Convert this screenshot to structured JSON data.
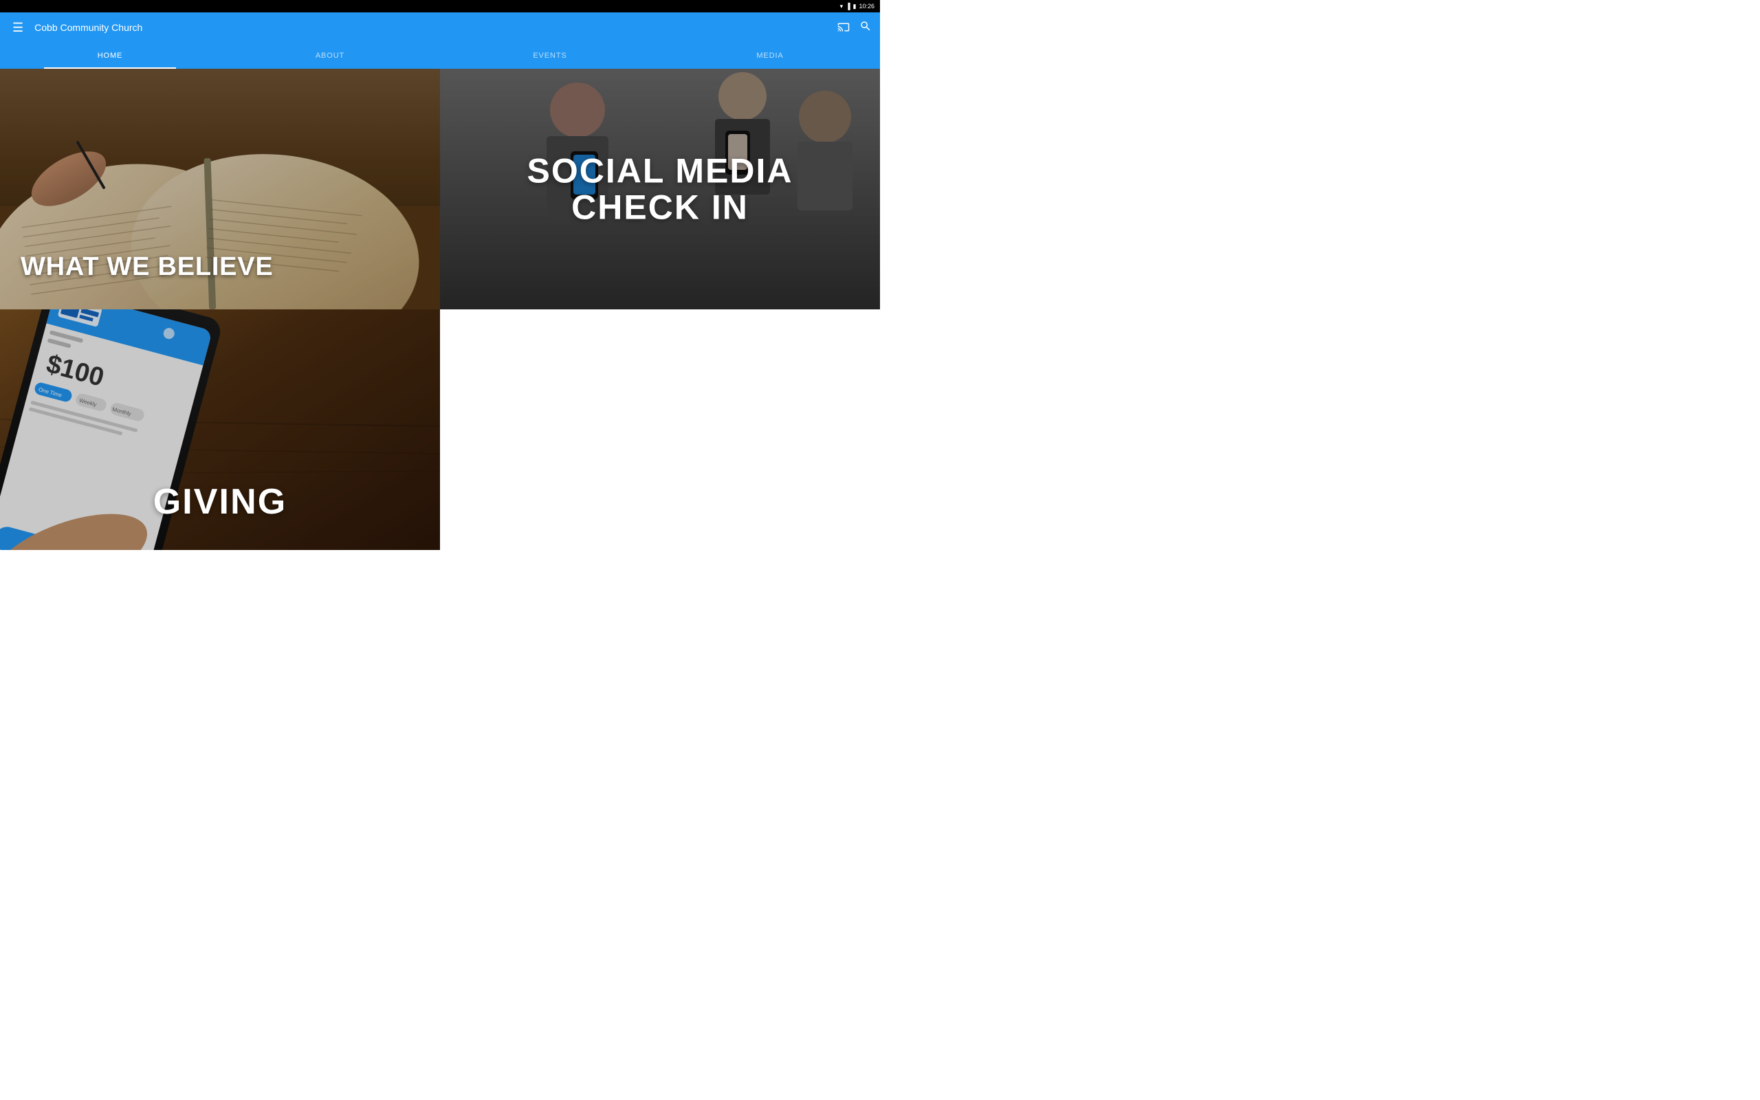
{
  "statusBar": {
    "time": "10:26"
  },
  "appBar": {
    "title": "Cobb Community Church",
    "hamburgerLabel": "☰",
    "castLabel": "cast",
    "searchLabel": "search"
  },
  "navTabs": [
    {
      "id": "home",
      "label": "HOME",
      "active": true
    },
    {
      "id": "about",
      "label": "ABOUT",
      "active": false
    },
    {
      "id": "events",
      "label": "EVENTS",
      "active": false
    },
    {
      "id": "media",
      "label": "MEDIA",
      "active": false
    }
  ],
  "tiles": [
    {
      "id": "what-we-believe",
      "label": "WHAT WE BELIEVE"
    },
    {
      "id": "social-media-check-in",
      "line1": "SOCIAL MEDIA",
      "line2": "CHECK IN"
    },
    {
      "id": "giving",
      "label": "GIVING"
    },
    {
      "id": "empty",
      "label": ""
    }
  ],
  "colors": {
    "appBarBlue": "#2196F3",
    "white": "#ffffff"
  }
}
